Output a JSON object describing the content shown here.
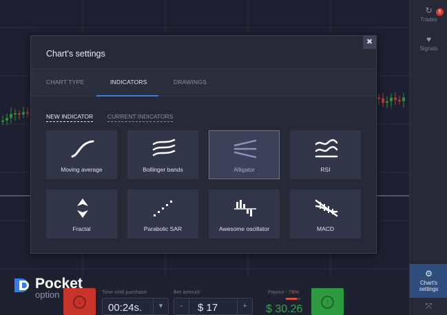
{
  "modal": {
    "title": "Chart's settings",
    "close_icon": "close-icon",
    "tabs": [
      {
        "label": "CHART TYPE",
        "active": false
      },
      {
        "label": "INDICATORS",
        "active": true
      },
      {
        "label": "DRAWINGS",
        "active": false
      }
    ],
    "subtabs": [
      {
        "label": "NEW INDICATOR",
        "active": true
      },
      {
        "label": "CURRENT INDICATORS",
        "active": false
      }
    ],
    "indicators": [
      {
        "label": "Moving average",
        "icon": "moving-average-icon",
        "selected": false
      },
      {
        "label": "Bollinger bands",
        "icon": "bollinger-bands-icon",
        "selected": false
      },
      {
        "label": "Alligator",
        "icon": "alligator-icon",
        "selected": true
      },
      {
        "label": "RSI",
        "icon": "rsi-icon",
        "selected": false
      },
      {
        "label": "Fractal",
        "icon": "fractal-icon",
        "selected": false
      },
      {
        "label": "Parabolic SAR",
        "icon": "parabolic-sar-icon",
        "selected": false
      },
      {
        "label": "Awesome oscillator",
        "icon": "awesome-oscillator-icon",
        "selected": false
      },
      {
        "label": "MACD",
        "icon": "macd-icon",
        "selected": false
      }
    ],
    "accent_color": "#3d7de0"
  },
  "right_panel": {
    "trades_label": "Trades",
    "trades_badge": "6",
    "signals_label": "Signals",
    "chart_settings_label_1": "Chart's",
    "chart_settings_label_2": "settings"
  },
  "logo": {
    "word1": "Pocket",
    "word2": "option"
  },
  "trade_panel": {
    "time_label": "Time until purchase",
    "time_value": "00:24s.",
    "bet_label": "Bet amount",
    "bet_value": "$ 17",
    "bet_minus": "-",
    "bet_plus": "+",
    "payout_label": "Payout -",
    "payout_percent": "78%",
    "payout_fill": 0.78,
    "payout_value": "$ 30.26"
  },
  "colors": {
    "down": "#c8332a",
    "up": "#2e9a3f",
    "payout_text": "#36a24a",
    "badge": "#d23b2f"
  }
}
